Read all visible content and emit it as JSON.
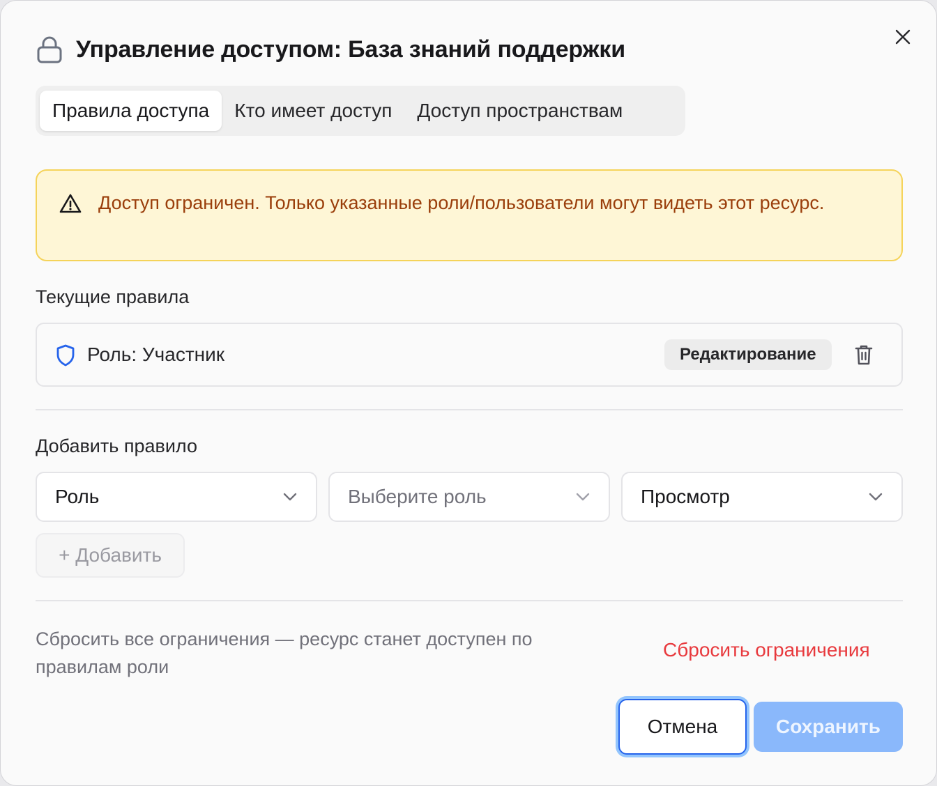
{
  "dialog": {
    "title": "Управление доступом: База знаний поддержки",
    "title_icon": "lock-icon",
    "close_icon": "close-icon"
  },
  "tabs": [
    {
      "label": "Правила доступа",
      "active": true
    },
    {
      "label": "Кто имеет доступ",
      "active": false
    },
    {
      "label": "Доступ пространствам",
      "active": false
    }
  ],
  "alert": {
    "icon": "warning-icon",
    "text": "Доступ ограничен. Только указанные роли/пользователи могут видеть этот ресурс."
  },
  "current_rules": {
    "heading": "Текущие правила",
    "items": [
      {
        "icon": "shield-icon",
        "label": "Роль: Участник",
        "permission": "Редактирование",
        "delete_icon": "trash-icon"
      }
    ]
  },
  "add_rule": {
    "heading": "Добавить правило",
    "type_select": "Роль",
    "role_select_placeholder": "Выберите роль",
    "permission_select": "Просмотр",
    "add_button": "+ Добавить"
  },
  "reset": {
    "hint": "Сбросить все ограничения — ресурс станет доступен по правилам роли",
    "link": "Сбросить ограничения"
  },
  "footer": {
    "cancel": "Отмена",
    "save": "Сохранить"
  },
  "colors": {
    "alert_bg": "#fef6d6",
    "alert_border": "#f5d35a",
    "alert_text": "#9a3e0b",
    "danger": "#e8393d",
    "primary": "#2563eb",
    "primary_disabled": "#8ab8fb"
  }
}
